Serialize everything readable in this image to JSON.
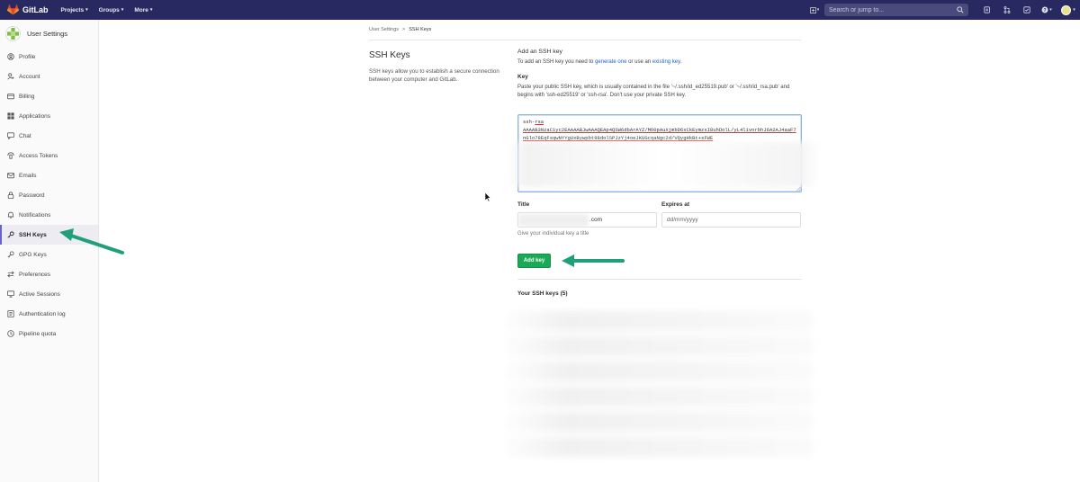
{
  "topbar": {
    "brand": "GitLab",
    "menu": [
      {
        "label": "Projects"
      },
      {
        "label": "Groups"
      },
      {
        "label": "More"
      }
    ],
    "search_placeholder": "Search or jump to...",
    "colors": {
      "bar": "#292961",
      "logo": "#fc6d26"
    }
  },
  "sidebar": {
    "title": "User Settings",
    "items": [
      {
        "label": "Profile",
        "icon": "profile-icon"
      },
      {
        "label": "Account",
        "icon": "account-icon"
      },
      {
        "label": "Billing",
        "icon": "billing-icon"
      },
      {
        "label": "Applications",
        "icon": "applications-icon"
      },
      {
        "label": "Chat",
        "icon": "chat-icon"
      },
      {
        "label": "Access Tokens",
        "icon": "token-icon"
      },
      {
        "label": "Emails",
        "icon": "email-icon"
      },
      {
        "label": "Password",
        "icon": "lock-icon"
      },
      {
        "label": "Notifications",
        "icon": "bell-icon"
      },
      {
        "label": "SSH Keys",
        "icon": "key-icon",
        "active": true
      },
      {
        "label": "GPG Keys",
        "icon": "key-icon"
      },
      {
        "label": "Preferences",
        "icon": "preferences-icon"
      },
      {
        "label": "Active Sessions",
        "icon": "monitor-icon"
      },
      {
        "label": "Authentication log",
        "icon": "list-icon"
      },
      {
        "label": "Pipeline quota",
        "icon": "quota-icon"
      }
    ]
  },
  "breadcrumb": {
    "parent": "User Settings",
    "separator": ">",
    "current": "SSH Keys"
  },
  "section": {
    "title": "SSH Keys",
    "description": "SSH keys allow you to establish a secure connection between your computer and GitLab."
  },
  "add_key": {
    "heading": "Add an SSH key",
    "intro_prefix": "To add an SSH key you need to ",
    "intro_link1": "generate one",
    "intro_mid": " or use an ",
    "intro_link2": "existing key",
    "intro_suffix": ".",
    "key_label": "Key",
    "key_help": "Paste your public SSH key, which is usually contained in the file '~/.ssh/id_ed25519.pub' or '~/.ssh/id_rsa.pub' and begins with 'ssh-ed25519' or 'ssh-rsa'. Don't use your private SSH key.",
    "key_value_prefix": "ssh-",
    "key_value_rsa": "rsa",
    "key_value_body": "AAAAB3NzaC1yc2EAAAABJwAAAQEAp4QSW6dbArAYZ/MO0pAuXjmbD6xCkEymzsI8uhDolL/yL4l1vnrbhJ6A2AJ4aaF7nGlo78EqFsqwNYYgUxBywpbt98dolSPJzYj4oeJKUGcqaNgc2d/VQygHkBt+sFWE",
    "title_label": "Title",
    "title_value": ".com",
    "expires_label": "Expires at",
    "expires_placeholder": "dd/mm/yyyy",
    "title_hint": "Give your individual key a title",
    "button": "Add key",
    "button_color": "#1aaa55"
  },
  "your_keys": {
    "title": "Your SSH keys (5)"
  }
}
